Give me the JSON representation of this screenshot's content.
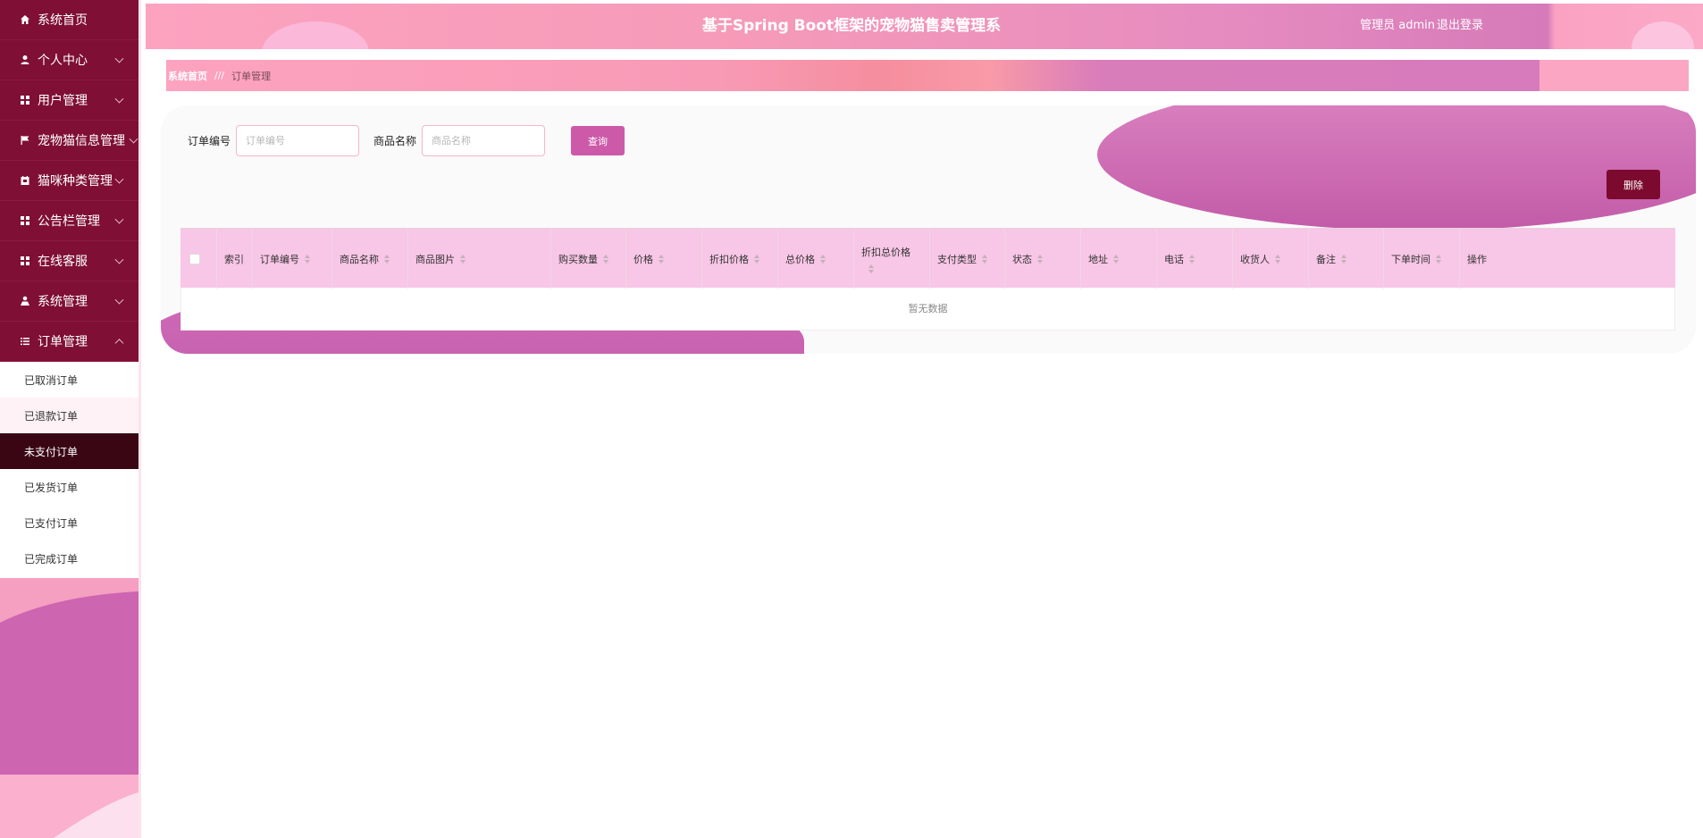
{
  "sidebar": {
    "items": [
      {
        "label": "系统首页",
        "icon": "home-icon",
        "has_caret": false
      },
      {
        "label": "个人中心",
        "icon": "user-icon",
        "has_caret": true
      },
      {
        "label": "用户管理",
        "icon": "grid-icon",
        "has_caret": true
      },
      {
        "label": "宠物猫信息管理",
        "icon": "flag-icon",
        "has_caret": true
      },
      {
        "label": "猫咪种类管理",
        "icon": "calendar-icon",
        "has_caret": true
      },
      {
        "label": "公告栏管理",
        "icon": "grid-icon",
        "has_caret": true
      },
      {
        "label": "在线客服",
        "icon": "grid-icon",
        "has_caret": true
      },
      {
        "label": "系统管理",
        "icon": "person-icon",
        "has_caret": true
      },
      {
        "label": "订单管理",
        "icon": "list-icon",
        "has_caret": true,
        "expanded": true
      }
    ],
    "sub_items": [
      {
        "label": "已取消订单"
      },
      {
        "label": "已退款订单"
      },
      {
        "label": "未支付订单"
      },
      {
        "label": "已发货订单"
      },
      {
        "label": "已支付订单"
      },
      {
        "label": "已完成订单"
      }
    ]
  },
  "header": {
    "title": "基于Spring Boot框架的宠物猫售卖管理系",
    "user": "管理员 admin",
    "logout": "退出登录"
  },
  "breadcrumb": {
    "home": "系统首页",
    "separator": "///",
    "current": "订单管理"
  },
  "search": {
    "order_no_label": "订单编号",
    "order_no_placeholder": "订单编号",
    "product_name_label": "商品名称",
    "product_name_placeholder": "商品名称",
    "query_button": "查询"
  },
  "actions": {
    "delete_button": "删除"
  },
  "table": {
    "columns": [
      {
        "label": "索引",
        "sortable": false
      },
      {
        "label": "订单编号",
        "sortable": true
      },
      {
        "label": "商品名称",
        "sortable": true
      },
      {
        "label": "商品图片",
        "sortable": true
      },
      {
        "label": "购买数量",
        "sortable": true
      },
      {
        "label": "价格",
        "sortable": true
      },
      {
        "label": "折扣价格",
        "sortable": true
      },
      {
        "label": "总价格",
        "sortable": true
      },
      {
        "label": "折扣总价格",
        "sortable": true
      },
      {
        "label": "支付类型",
        "sortable": true
      },
      {
        "label": "状态",
        "sortable": true
      },
      {
        "label": "地址",
        "sortable": true
      },
      {
        "label": "电话",
        "sortable": true
      },
      {
        "label": "收货人",
        "sortable": true
      },
      {
        "label": "备注",
        "sortable": true
      },
      {
        "label": "下单时间",
        "sortable": true
      },
      {
        "label": "操作",
        "sortable": false
      }
    ],
    "empty_text": "暂无数据"
  },
  "colors": {
    "sidebar_bg": "#7f0f34",
    "active_sub_bg": "#3a0614",
    "accent_pink": "#cc5aa9",
    "delete_bg": "#7c0a2f",
    "table_header_bg": "#f8c6e6"
  }
}
